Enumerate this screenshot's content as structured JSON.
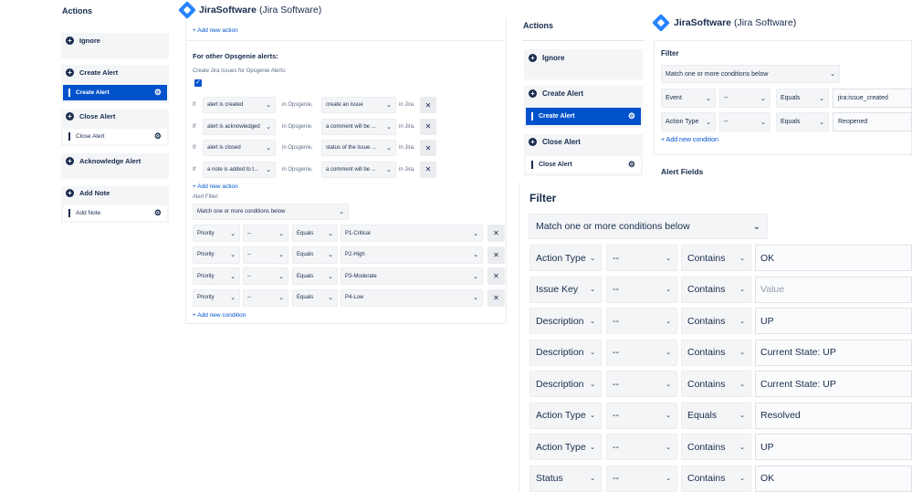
{
  "left": {
    "actions_title": "Actions",
    "groups": [
      {
        "head": "Ignore"
      },
      {
        "head": "Create Alert",
        "item": "Create Alert"
      },
      {
        "head": "Close Alert",
        "item": "Close Alert"
      },
      {
        "head": "Acknowledge Alert"
      },
      {
        "head": "Add Note",
        "item": "Add Note"
      }
    ]
  },
  "mid": {
    "title_bold": "JiraSoftware",
    "title_rest": " (Jira Software)",
    "add_action_top": "+ Add new action",
    "other_heading": "For other Opsgenie alerts:",
    "create_issues_label": "Create Jira Issues for Opsgenie Alerts:",
    "rules": [
      {
        "if": "If",
        "cond": "alert is created",
        "in1": "in Opsgenie,",
        "action": "create an issue",
        "in2": "in Jira."
      },
      {
        "if": "If",
        "cond": "alert is acknowledged",
        "in1": "in Opsgenie,",
        "action": "a comment will be ...",
        "in2": "in Jira."
      },
      {
        "if": "If",
        "cond": "alert is closed",
        "in1": "in Opsgenie,",
        "action": "status of the issue ...",
        "in2": "in Jira."
      },
      {
        "if": "If",
        "cond": "a note is added to t...",
        "in1": "in Opsgenie,",
        "action": "a comment will be ...",
        "in2": "in Jira."
      }
    ],
    "add_action_bottom": "+ Add new action",
    "alert_filter_label": "Alert Filter:",
    "match": "Match one or more conditions below",
    "conditions": [
      {
        "field": "Priority",
        "neg": "--",
        "op": "Equals",
        "value": "P1-Critical"
      },
      {
        "field": "Priority",
        "neg": "--",
        "op": "Equals",
        "value": "P2-High"
      },
      {
        "field": "Priority",
        "neg": "--",
        "op": "Equals",
        "value": "P3-Moderate"
      },
      {
        "field": "Priority",
        "neg": "--",
        "op": "Equals",
        "value": "P4-Low"
      }
    ],
    "add_condition": "+ Add new condition"
  },
  "right": {
    "actions_title": "Actions",
    "groups": [
      {
        "head": "Ignore"
      },
      {
        "head": "Create Alert",
        "item": "Create Alert"
      },
      {
        "head": "Close Alert",
        "item": "Close Alert"
      }
    ],
    "title_bold": "JiraSoftware",
    "title_rest": " (Jira Software)",
    "filter_label": "Filter",
    "match": "Match one or more conditions below",
    "conditions": [
      {
        "field": "Event",
        "neg": "--",
        "op": "Equals",
        "value": "jira:issue_created"
      },
      {
        "field": "Action Type",
        "neg": "--",
        "op": "Equals",
        "value": "Reopened"
      }
    ],
    "add_condition": "+ Add new condition",
    "alert_fields": "Alert Fields"
  },
  "big": {
    "filter_label": "Filter",
    "match": "Match one or more conditions below",
    "conditions": [
      {
        "field": "Action Type",
        "neg": "--",
        "op": "Contains",
        "value": "OK",
        "placeholder": false
      },
      {
        "field": "Issue Key",
        "neg": "--",
        "op": "Contains",
        "value": "Value",
        "placeholder": true
      },
      {
        "field": "Description",
        "neg": "--",
        "op": "Contains",
        "value": "UP",
        "placeholder": false
      },
      {
        "field": "Description",
        "neg": "--",
        "op": "Contains",
        "value": "Current State: UP",
        "placeholder": false
      },
      {
        "field": "Description",
        "neg": "--",
        "op": "Contains",
        "value": "Current State: UP",
        "placeholder": false
      },
      {
        "field": "Action Type",
        "neg": "--",
        "op": "Equals",
        "value": "Resolved",
        "placeholder": false
      },
      {
        "field": "Action Type",
        "neg": "--",
        "op": "Contains",
        "value": "UP",
        "placeholder": false
      },
      {
        "field": "Status",
        "neg": "--",
        "op": "Contains",
        "value": "OK",
        "placeholder": false
      }
    ]
  },
  "colors": {
    "accent": "#0052cc",
    "logo": "#2684ff",
    "text": "#172b4d",
    "group_bg": "#f4f5f7"
  },
  "icons": [
    "plus-circle-icon",
    "drag-handle-icon",
    "gear-icon",
    "chevron-down-icon",
    "close-icon",
    "jira-logo-icon"
  ]
}
